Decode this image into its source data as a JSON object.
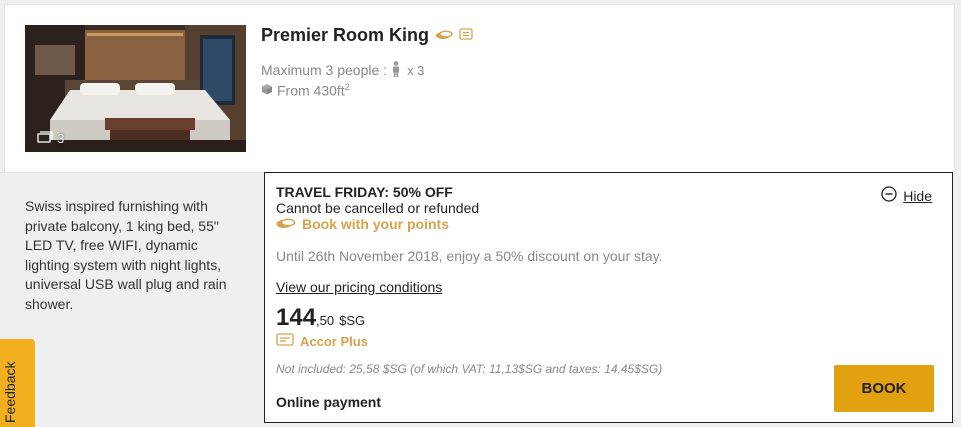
{
  "room": {
    "title": "Premier Room King",
    "max_people": "Maximum 3 people :",
    "people_count": "x 3",
    "size_prefix": "From 430ft",
    "size_sup": "2",
    "photo_count": "3",
    "description": "Swiss inspired furnishing with private balcony, 1 king bed, 55\" LED TV, free WIFI, dynamic lighting system with night lights, universal USB wall plug and rain shower."
  },
  "rate": {
    "name": "TRAVEL FRIDAY: 50% OFF",
    "cancellation": "Cannot be cancelled or refunded",
    "points_label": "Book with your points",
    "hide_label": "Hide",
    "promo": "Until 26th November 2018, enjoy a 50% discount on your stay.",
    "pricing_link": "View our pricing conditions",
    "price_int": "144",
    "price_dec": ",50",
    "currency": "$SG",
    "loyalty_label": "Accor Plus",
    "not_included": "Not included: 25,58 $SG  (of which VAT: 11,13$SG and taxes: 14,45$SG)",
    "payment": "Online payment",
    "book_label": "BOOK"
  },
  "feedback_label": "Feedback",
  "colors": {
    "accent": "#e2a20f",
    "points_gold": "#d8a24a",
    "feedback_tab": "#f2b01e"
  },
  "icons": [
    "points-icon",
    "room-info-icon",
    "person-icon",
    "cube-icon",
    "photos-icon",
    "minus-circle-icon",
    "loyalty-card-icon"
  ]
}
